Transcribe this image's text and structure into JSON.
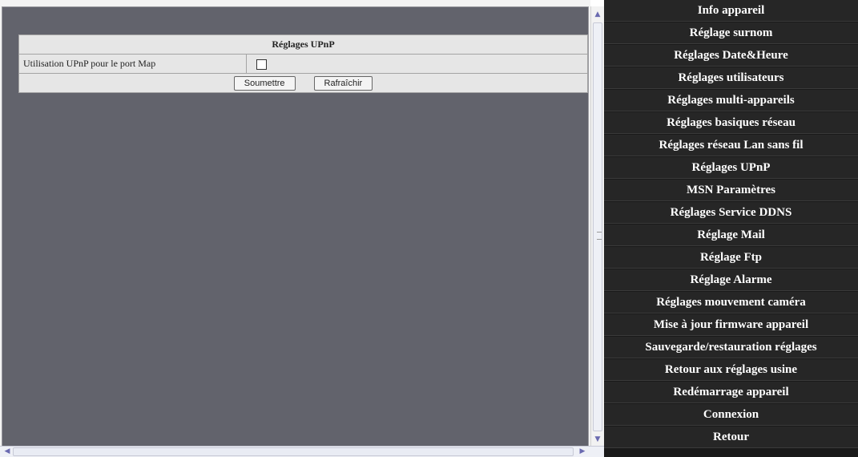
{
  "upnp_panel": {
    "title": "Réglages UPnP",
    "option_label": "Utilisation UPnP pour le port Map",
    "option_checked": false,
    "submit_label": "Soumettre",
    "refresh_label": "Rafraîchir"
  },
  "nav": {
    "items": [
      "Info appareil",
      "Réglage surnom",
      "Réglages Date&Heure",
      "Réglages utilisateurs",
      "Réglages multi-appareils",
      "Réglages basiques réseau",
      "Réglages réseau Lan sans fil",
      "Réglages UPnP",
      "MSN Paramètres",
      "Réglages Service DDNS",
      "Réglage Mail",
      "Réglage Ftp",
      "Réglage Alarme",
      "Réglages mouvement caméra",
      "Mise à jour firmware appareil",
      "Sauvegarde/restauration réglages",
      "Retour aux réglages usine",
      "Redémarrage appareil",
      "Connexion",
      "Retour"
    ]
  },
  "colors": {
    "content_background": "#62636c",
    "nav_background": "#262626",
    "nav_text": "#ffffff"
  }
}
